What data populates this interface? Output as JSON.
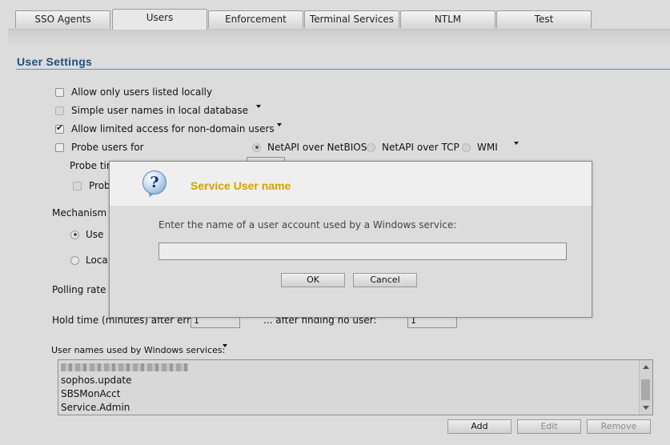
{
  "tabs": [
    {
      "label": "SSO Agents",
      "active": false
    },
    {
      "label": "Users",
      "active": true
    },
    {
      "label": "Enforcement",
      "active": false
    },
    {
      "label": "Terminal Services",
      "active": false
    },
    {
      "label": "NTLM",
      "active": false
    },
    {
      "label": "Test",
      "active": false
    }
  ],
  "section": {
    "title": "User Settings"
  },
  "options": {
    "allow_local": {
      "label": "Allow only users listed locally",
      "checked": false
    },
    "simple_names": {
      "label": "Simple user names in local database",
      "checked": false
    },
    "limited_access": {
      "label": "Allow limited access for non-domain users",
      "checked": true
    },
    "probe_users": {
      "label": "Probe users for",
      "checked": false
    }
  },
  "probe_methods": {
    "netbios": "NetAPI over NetBIOS",
    "tcp": "NetAPI over TCP",
    "wmi": "WMI",
    "selected": "netbios"
  },
  "partial_labels": {
    "probe_timeout": "Probe tim",
    "probe_sub": "Prob",
    "mechanism": "Mechanism f",
    "use": "Use",
    "local": "Loca",
    "polling": "Polling rate (r"
  },
  "hold_time": {
    "error_label": "Hold time (minutes) after error:",
    "error_value": "1",
    "nouser_label": "... after finding no user:",
    "nouser_value": "1"
  },
  "services": {
    "label": "User names used by Windows services:",
    "items": [
      "sophos.update",
      "SBSMonAcct",
      "Service.Admin"
    ]
  },
  "buttons": {
    "add": "Add",
    "edit": "Edit",
    "remove": "Remove"
  },
  "dialog": {
    "title": "Service User name",
    "prompt": "Enter the name of a user account used by a Windows service:",
    "input_value": "",
    "ok": "OK",
    "cancel": "Cancel"
  },
  "colors": {
    "title_blue": "#1f4e79",
    "dialog_title": "#d6a100"
  }
}
